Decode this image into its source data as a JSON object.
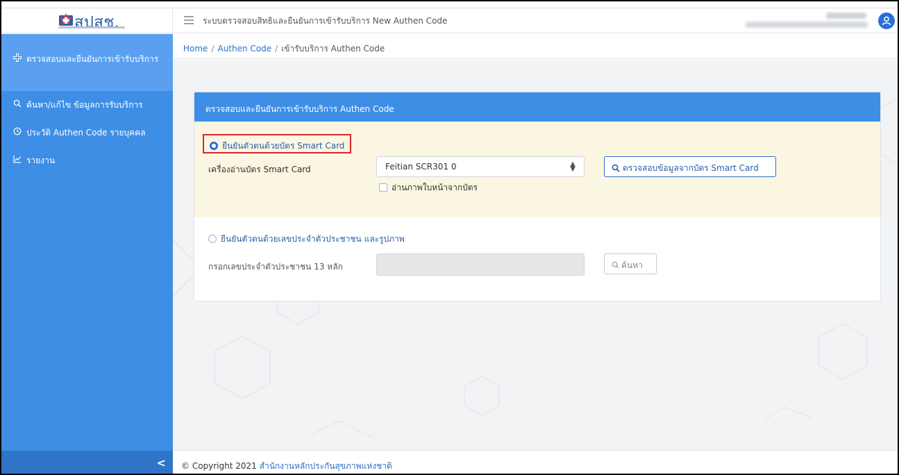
{
  "header": {
    "logo_text": "สปสช.",
    "app_title": "ระบบตรวจสอบสิทธิและยืนยันการเข้ารับบริการ New Authen Code"
  },
  "sidebar": {
    "items": [
      {
        "icon": "plus-cross-icon",
        "label": "ตรวจสอบและยืนยันการเข้ารับบริการ"
      },
      {
        "icon": "search-icon",
        "label": "ค้นหา/แก้ไข ข้อมูลการรับบริการ"
      },
      {
        "icon": "history-icon",
        "label": "ประวัติ Authen Code รายบุคคล"
      },
      {
        "icon": "chart-line-icon",
        "label": "รายงาน"
      }
    ],
    "collapse_glyph": "<"
  },
  "breadcrumb": {
    "home": "Home",
    "level1": "Authen Code",
    "current": "เข้ารับบริการ Authen Code",
    "separator": "/"
  },
  "card": {
    "title": "ตรวจสอบและยืนยันการเข้ารับบริการ Authen Code",
    "smartcard": {
      "radio_label": "ยืนยันตัวตนด้วยบัตร Smart Card",
      "selected": true,
      "reader_label": "เครื่องอ่านบัตร Smart Card",
      "reader_value": "Feitian SCR301 0",
      "read_photo_label": "อ่านภาพใบหน้าจากบัตร",
      "read_photo_checked": false,
      "check_button_label": "ตรวจสอบข้อมูลจากบัตร Smart Card"
    },
    "citizen": {
      "radio_label": "ยืนยันตัวตนด้วยเลขประจำตัวประชาชน และรูปภาพ",
      "selected": false,
      "id_label": "กรอกเลขประจำตัวประชาชน 13 หลัก",
      "id_value": "",
      "search_button_label": "ค้นหา"
    }
  },
  "footer": {
    "prefix": "© Copyright 2021",
    "org": "สำนักงานหลักประกันสุขภาพแห่งชาติ"
  },
  "colors": {
    "primary": "#3f8ee6",
    "sidebar_active": "#5b9ff0",
    "highlight_panel": "#fbf6e1",
    "annotation_box": "#d9262f",
    "link": "#2b6fc6"
  }
}
